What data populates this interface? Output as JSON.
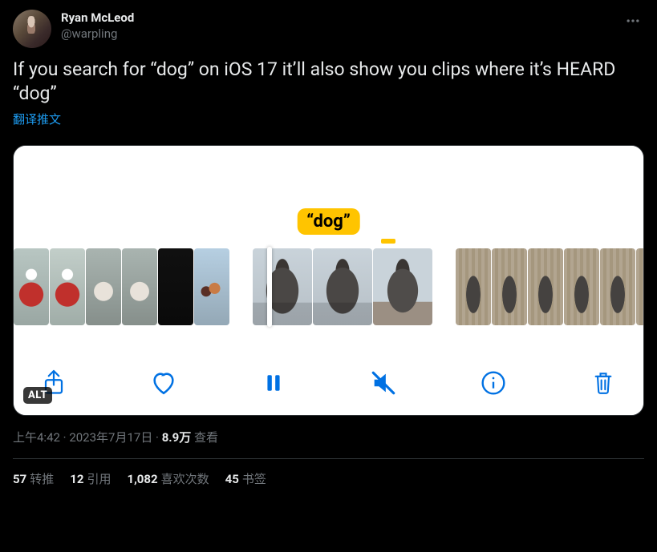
{
  "author": {
    "display_name": "Ryan McLeod",
    "handle": "@warpling"
  },
  "tweet_text": "If you search for “dog” on iOS 17 it’ll also show you clips where it’s HEARD “dog”",
  "translate": "翻译推文",
  "media": {
    "highlight_label": "“dog”",
    "alt_badge": "ALT"
  },
  "meta": {
    "time": "上午4:42",
    "dot1": " · ",
    "date": "2023年7月17日",
    "dot2": " · ",
    "views_num": "8.9万",
    "views_label": " 查看"
  },
  "stats": {
    "retweets_num": "57",
    "retweets_label": "转推",
    "quotes_num": "12",
    "quotes_label": "引用",
    "likes_num": "1,082",
    "likes_label": "喜欢次数",
    "bookmarks_num": "45",
    "bookmarks_label": "书签"
  }
}
